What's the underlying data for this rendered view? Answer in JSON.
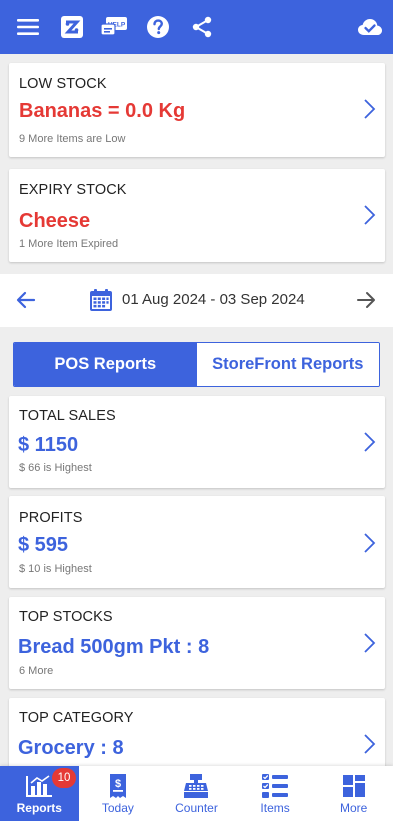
{
  "colors": {
    "primary": "#3d63dd",
    "alert": "#e53935",
    "background": "#eeeeee"
  },
  "toolbar": {
    "icons": [
      "menu-icon",
      "logo-icon",
      "help-chat-icon",
      "question-icon",
      "share-icon",
      "cloud-check-icon"
    ],
    "help_badge_text": "HELP"
  },
  "low_stock": {
    "title": "LOW STOCK",
    "highlight": "Bananas = 0.0 Kg",
    "more_count": "9 More",
    "more_text": "Items are Low"
  },
  "expiry_stock": {
    "title": "EXPIRY STOCK",
    "highlight": "Cheese",
    "more_count": "1 More",
    "more_text": "Item Expired"
  },
  "date_range": {
    "text": "01 Aug 2024 - 03 Sep 2024"
  },
  "report_tabs": [
    {
      "label": "POS Reports",
      "active": true
    },
    {
      "label": "StoreFront Reports",
      "active": false
    }
  ],
  "cards": {
    "total_sales": {
      "title": "TOTAL SALES",
      "value": "$ 1150",
      "sub": "$ 66 is Highest"
    },
    "profits": {
      "title": "PROFITS",
      "value": "$ 595",
      "sub": "$ 10 is Highest"
    },
    "top_stocks": {
      "title": "TOP STOCKS",
      "value": "Bread 500gm Pkt : 8",
      "sub": "6 More"
    },
    "top_category": {
      "title": "TOP CATEGORY",
      "value": "Grocery : 8"
    }
  },
  "bottom_nav": {
    "items": [
      {
        "label": "Reports",
        "icon": "reports-chart-icon",
        "active": true,
        "badge": "10"
      },
      {
        "label": "Today",
        "icon": "receipt-dollar-icon",
        "active": false
      },
      {
        "label": "Counter",
        "icon": "cash-register-icon",
        "active": false
      },
      {
        "label": "Items",
        "icon": "checklist-icon",
        "active": false
      },
      {
        "label": "More",
        "icon": "grid-more-icon",
        "active": false
      }
    ]
  }
}
